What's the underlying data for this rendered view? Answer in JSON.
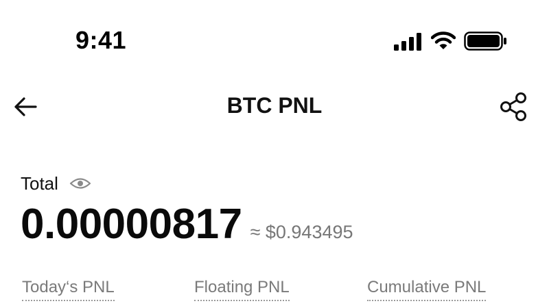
{
  "status_bar": {
    "time": "9:41",
    "icons": [
      "cellular-signal-icon",
      "wifi-icon",
      "battery-icon"
    ]
  },
  "header": {
    "title": "BTC PNL",
    "back_icon": "arrow-left-icon",
    "share_icon": "share-icon"
  },
  "total": {
    "label": "Total",
    "visibility_icon": "eye-icon",
    "value": "0.00000817",
    "usd_equivalent": "≈ $0.943495"
  },
  "pnl_tabs": [
    {
      "label": "Today‘s PNL"
    },
    {
      "label": "Floating PNL"
    },
    {
      "label": "Cumulative PNL"
    }
  ],
  "colors": {
    "text_primary": "#111111",
    "text_secondary": "#777777",
    "background": "#ffffff"
  }
}
